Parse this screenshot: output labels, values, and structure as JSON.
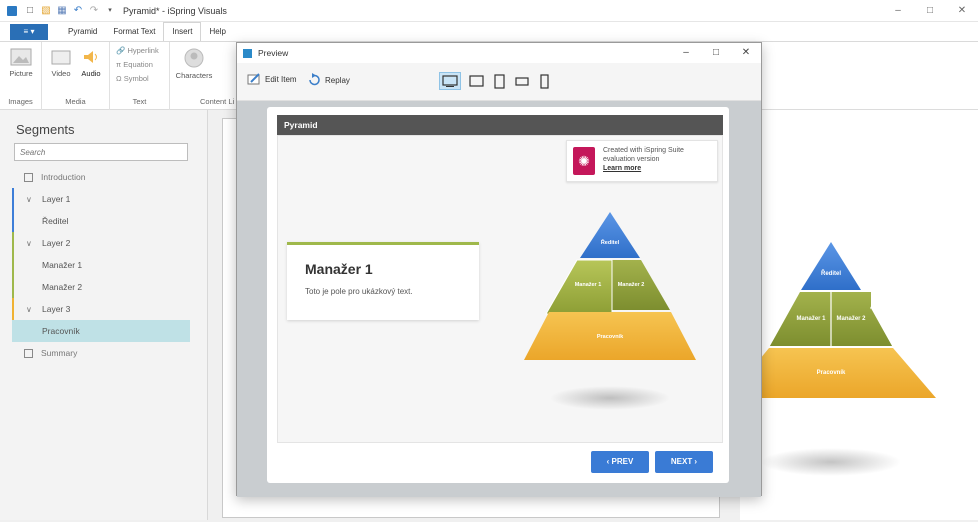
{
  "window": {
    "title": "Pyramid* - iSpring Visuals"
  },
  "win_controls": [
    "–",
    "□",
    "✕"
  ],
  "ribbon_tabs": [
    "Pyramid",
    "Format Text",
    "Insert",
    "Help"
  ],
  "file_tab": "≡ ▾",
  "ribbon": {
    "images": {
      "picture": "Picture",
      "group": "Images"
    },
    "media": {
      "video": "Video",
      "audio": "Audio",
      "group": "Media"
    },
    "text": {
      "hyperlink": "Hyperlink",
      "equation": "Equation",
      "symbol": "Symbol",
      "group": "Text"
    },
    "content": {
      "characters": "Characters",
      "group": "Content Li"
    }
  },
  "segments": {
    "title": "Segments",
    "search_placeholder": "Search",
    "items": [
      "Introduction",
      "Layer 1",
      "Ředitel",
      "Layer 2",
      "Manažer 1",
      "Manažer 2",
      "Layer 3",
      "Pracovník",
      "Summary"
    ]
  },
  "preview": {
    "title": "Preview",
    "edit_item": "Edit Item",
    "replay": "Replay",
    "controls": [
      "–",
      "□",
      "✕"
    ]
  },
  "player": {
    "header": "Pyramid",
    "eval": {
      "line1": "Created with iSpring Suite",
      "line2": "evaluation version",
      "link": "Learn more"
    },
    "card": {
      "title": "Manažer 1",
      "text": "Toto je pole pro ukázkový text."
    },
    "prev": "‹ PREV",
    "next": "NEXT ›"
  },
  "pyramid": {
    "top": "Ředitel",
    "mid_left": "Manažer 1",
    "mid_right": "Manažer 2",
    "bottom": "Pracovník"
  },
  "colors": {
    "blue": "#3d7ed8",
    "green": "#8fa03b",
    "yellow": "#f0b233",
    "accent": "#2b79c2"
  }
}
